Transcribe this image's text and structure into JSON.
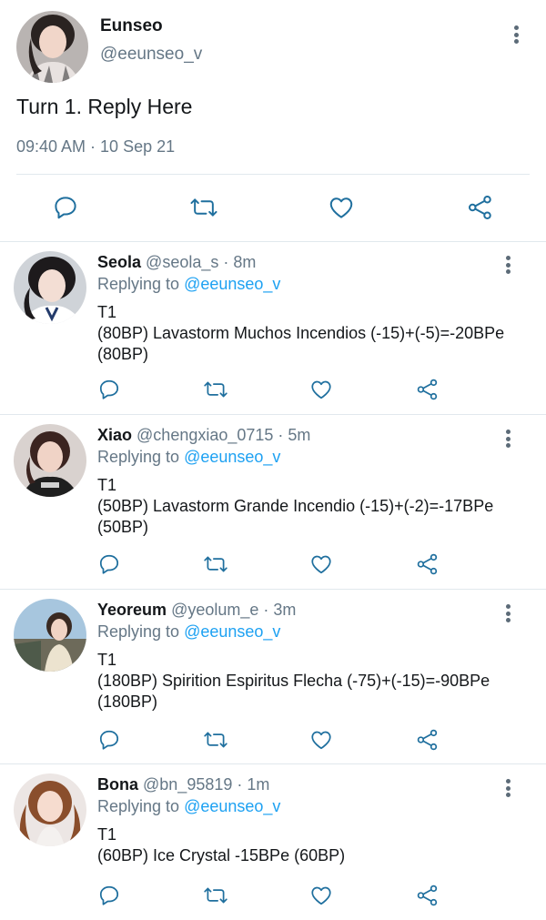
{
  "main_tweet": {
    "name": "Eunseo",
    "handle": "@eeunseo_v",
    "text": "Turn 1. Reply Here",
    "timestamp": "09:40 AM · 10 Sep 21",
    "actions": [
      "reply-icon",
      "retweet-icon",
      "like-icon",
      "share-icon"
    ]
  },
  "replies": [
    {
      "name": "Seola",
      "handle": "@seola_s · 8m",
      "replying_prefix": "Replying to",
      "replying_to": "@eeunseo_v",
      "line1": "T1",
      "line2": "(80BP) Lavastorm Muchos Incendios (-15)+(-5)=-20BPe",
      "line3": "(80BP)"
    },
    {
      "name": "Xiao",
      "handle": "@chengxiao_0715 · 5m",
      "replying_prefix": "Replying to",
      "replying_to": "@eeunseo_v",
      "line1": "T1",
      "line2": "(50BP) Lavastorm Grande Incendio (-15)+(-2)=-17BPe",
      "line3": "(50BP)"
    },
    {
      "name": "Yeoreum",
      "handle": "@yeolum_e · 3m",
      "replying_prefix": "Replying to",
      "replying_to": "@eeunseo_v",
      "line1": "T1",
      "line2": "(180BP) Spirition Espiritus Flecha (-75)+(-15)=-90BPe",
      "line3": "(180BP)"
    },
    {
      "name": "Bona",
      "handle": "@bn_95819 · 1m",
      "replying_prefix": "Replying to",
      "replying_to": "@eeunseo_v",
      "line1": "T1",
      "line2": "(60BP) Ice Crystal -15BPe (60BP)",
      "line3": ""
    }
  ],
  "colors": {
    "text": "#14171a",
    "secondary": "#657786",
    "link": "#1da1f2",
    "icon": "#1f6f9e",
    "divider": "#e1e8ed"
  }
}
